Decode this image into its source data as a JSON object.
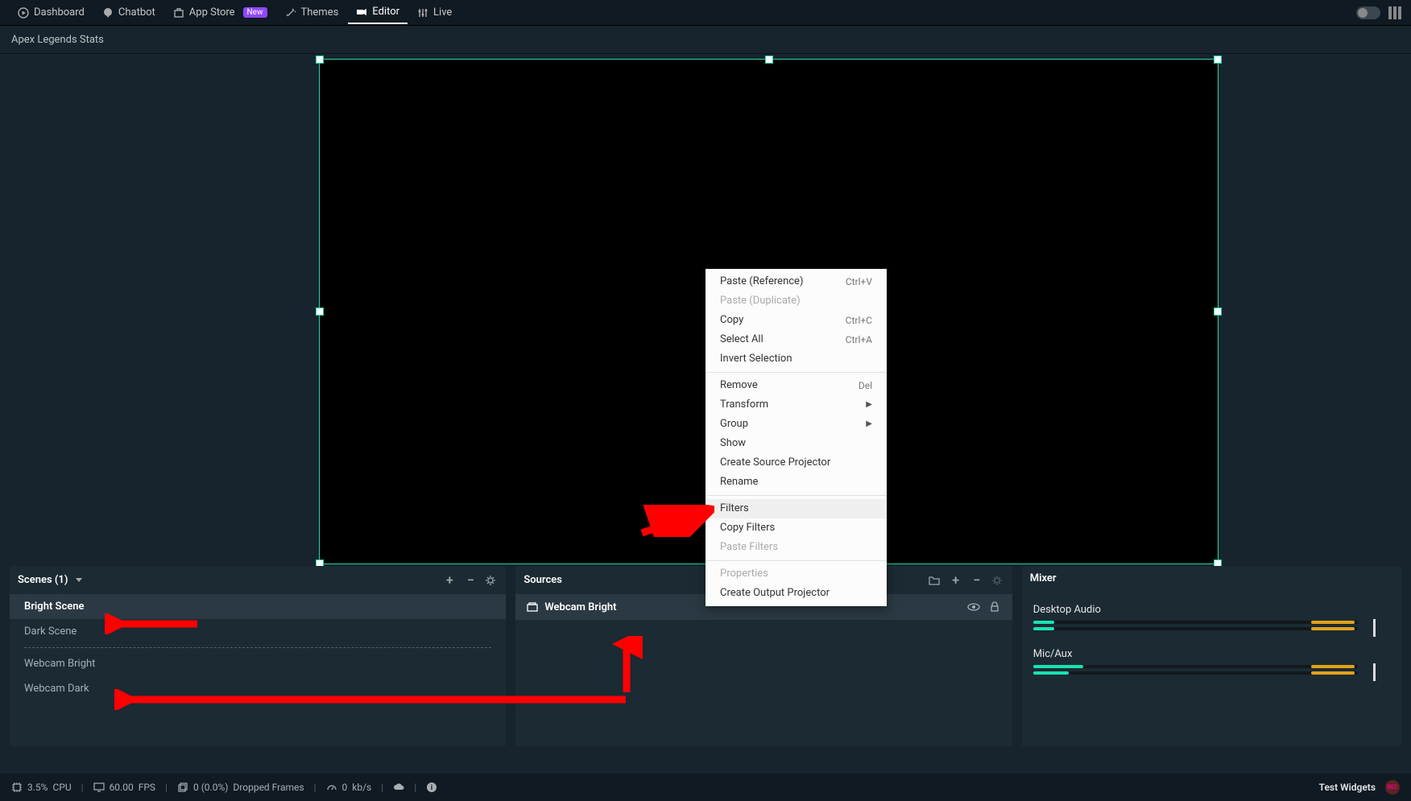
{
  "nav": {
    "dashboard": "Dashboard",
    "chatbot": "Chatbot",
    "app_store": "App Store",
    "new_badge": "New",
    "themes": "Themes",
    "editor": "Editor",
    "live": "Live"
  },
  "subtitle": "Apex Legends Stats",
  "context_menu": {
    "paste_ref": "Paste (Reference)",
    "paste_ref_short": "Ctrl+V",
    "paste_dup": "Paste (Duplicate)",
    "copy": "Copy",
    "copy_short": "Ctrl+C",
    "select_all": "Select All",
    "select_all_short": "Ctrl+A",
    "invert": "Invert Selection",
    "remove": "Remove",
    "remove_short": "Del",
    "transform": "Transform",
    "group": "Group",
    "show": "Show",
    "create_src_proj": "Create Source Projector",
    "rename": "Rename",
    "filters": "Filters",
    "copy_filters": "Copy Filters",
    "paste_filters": "Paste Filters",
    "properties": "Properties",
    "create_out_proj": "Create Output Projector"
  },
  "scenes_panel": {
    "title": "Scenes (1)",
    "items": [
      "Bright Scene",
      "Dark Scene",
      "Webcam Bright",
      "Webcam Dark"
    ]
  },
  "sources_panel": {
    "title": "Sources",
    "item": "Webcam Bright"
  },
  "mixer_panel": {
    "title": "Mixer",
    "desktop": "Desktop Audio",
    "mic": "Mic/Aux"
  },
  "status": {
    "cpu_pct": "3.5%",
    "cpu_label": "CPU",
    "fps_val": "60.00",
    "fps_label": "FPS",
    "dropped_val": "0 (0.0%)",
    "dropped_label": "Dropped Frames",
    "bitrate_val": "0",
    "bitrate_unit": "kb/s",
    "test_widgets": "Test Widgets",
    "rec_label": "REC"
  }
}
